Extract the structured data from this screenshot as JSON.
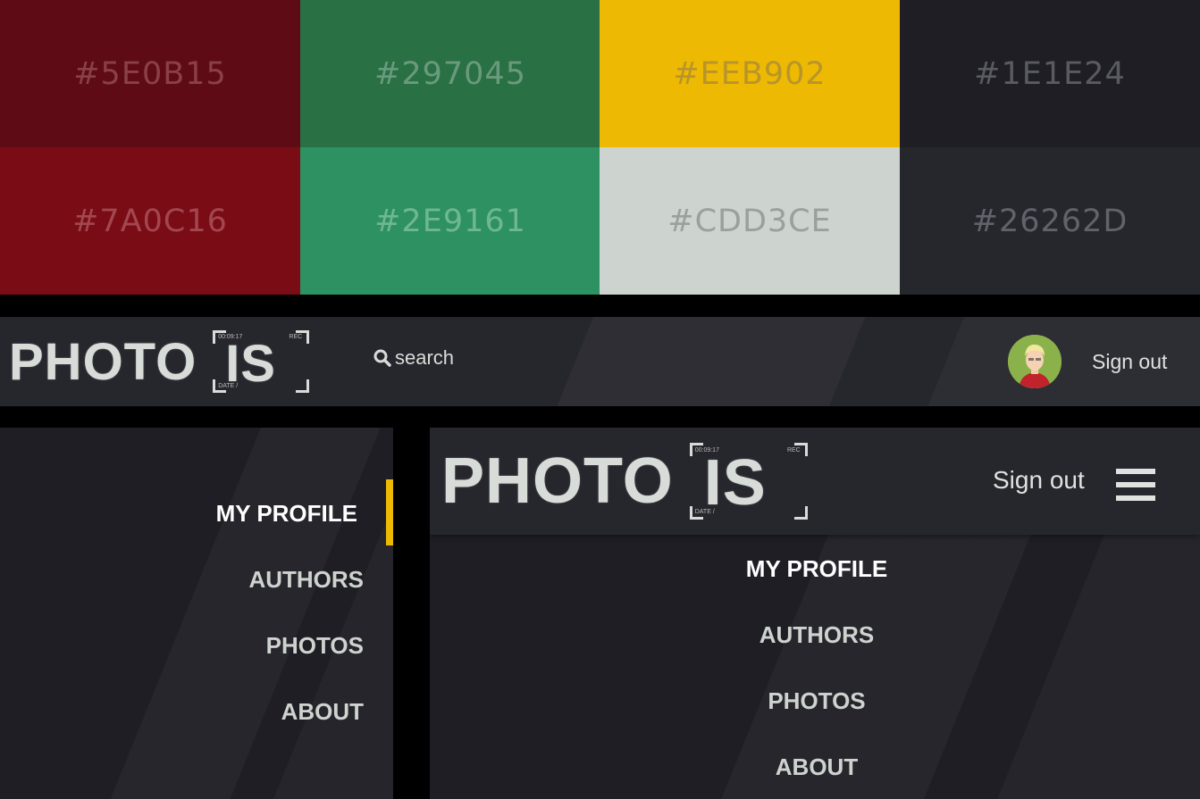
{
  "palette": [
    {
      "code": "#5E0B15",
      "bg": "#5e0b15",
      "text": "#8a4048"
    },
    {
      "code": "#297045",
      "bg": "#297045",
      "text": "#6a9a7c"
    },
    {
      "code": "#EEB902",
      "bg": "#eeb902",
      "text": "#b8952a"
    },
    {
      "code": "#1E1E24",
      "bg": "#1e1e24",
      "text": "#5a5a62"
    },
    {
      "code": "#7A0C16",
      "bg": "#7a0c16",
      "text": "#a2474f"
    },
    {
      "code": "#2E9161",
      "bg": "#2e9161",
      "text": "#6fb792"
    },
    {
      "code": "#CDD3CE",
      "bg": "#cdd3ce",
      "text": "#9aa09c"
    },
    {
      "code": "#26262D",
      "bg": "#26262d",
      "text": "#62626a"
    }
  ],
  "logo": {
    "word": "PHOTO",
    "framed": "IS",
    "rec": "REC",
    "time": "00:09:17",
    "date": "DATE /"
  },
  "header": {
    "search_label": "search",
    "signout_label": "Sign out"
  },
  "sidemenu": {
    "items": [
      "MY PROFILE",
      "AUTHORS",
      "PHOTOS",
      "ABOUT"
    ]
  },
  "mobile": {
    "signout_label": "Sign out",
    "items": [
      "MY PROFILE",
      "AUTHORS",
      "PHOTOS",
      "ABOUT"
    ]
  },
  "colors": {
    "accent": "#EEB902"
  }
}
